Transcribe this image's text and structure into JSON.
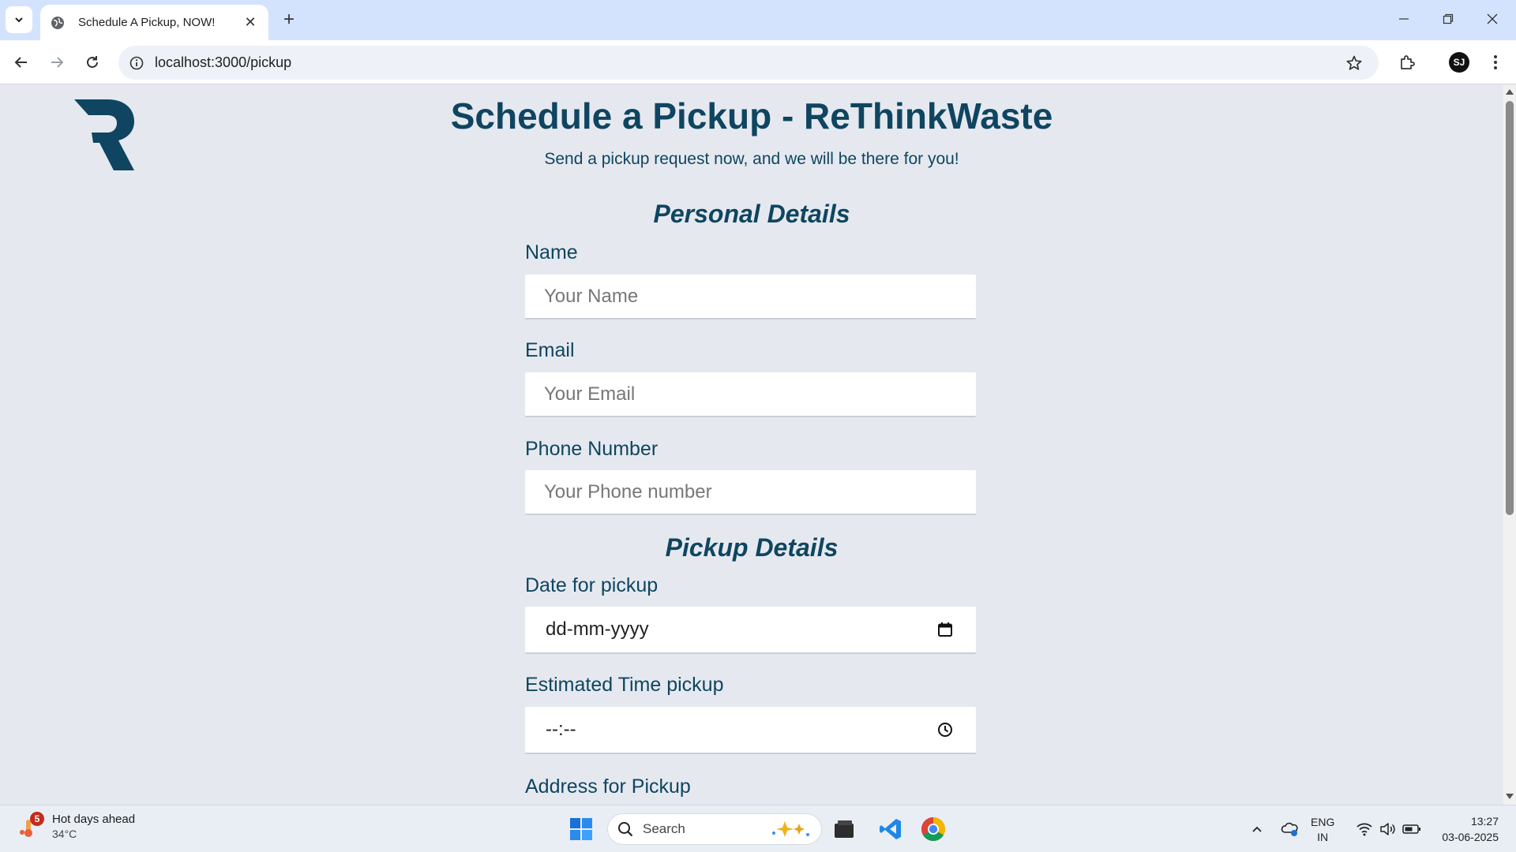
{
  "browser": {
    "tab_title": "Schedule A Pickup, NOW!",
    "tab_close": "✕",
    "new_tab": "+",
    "url": "localhost:3000/pickup",
    "profile_initial": "SJ"
  },
  "page": {
    "title": "Schedule a Pickup - ReThinkWaste",
    "subtitle": "Send a pickup request now, and we will be there for you!",
    "logo_letter": "R",
    "brand_color": "#0f4560"
  },
  "personal_details": {
    "heading": "Personal Details",
    "name_label": "Name",
    "name_placeholder": "Your Name",
    "email_label": "Email",
    "email_placeholder": "Your Email",
    "phone_label": "Phone Number",
    "phone_placeholder": "Your Phone number"
  },
  "pickup_details": {
    "heading": "Pickup Details",
    "date_label": "Date for pickup",
    "date_value": "dd-mm-yyyy",
    "time_label": "Estimated Time pickup",
    "time_value": "--:--",
    "address_label": "Address for Pickup"
  },
  "taskbar": {
    "weather_badge": "5",
    "weather_title": "Hot days ahead",
    "weather_temp": "34°C",
    "search_label": "Search",
    "lang_line1": "ENG",
    "lang_line2": "IN",
    "time": "13:27",
    "date": "03-06-2025"
  }
}
